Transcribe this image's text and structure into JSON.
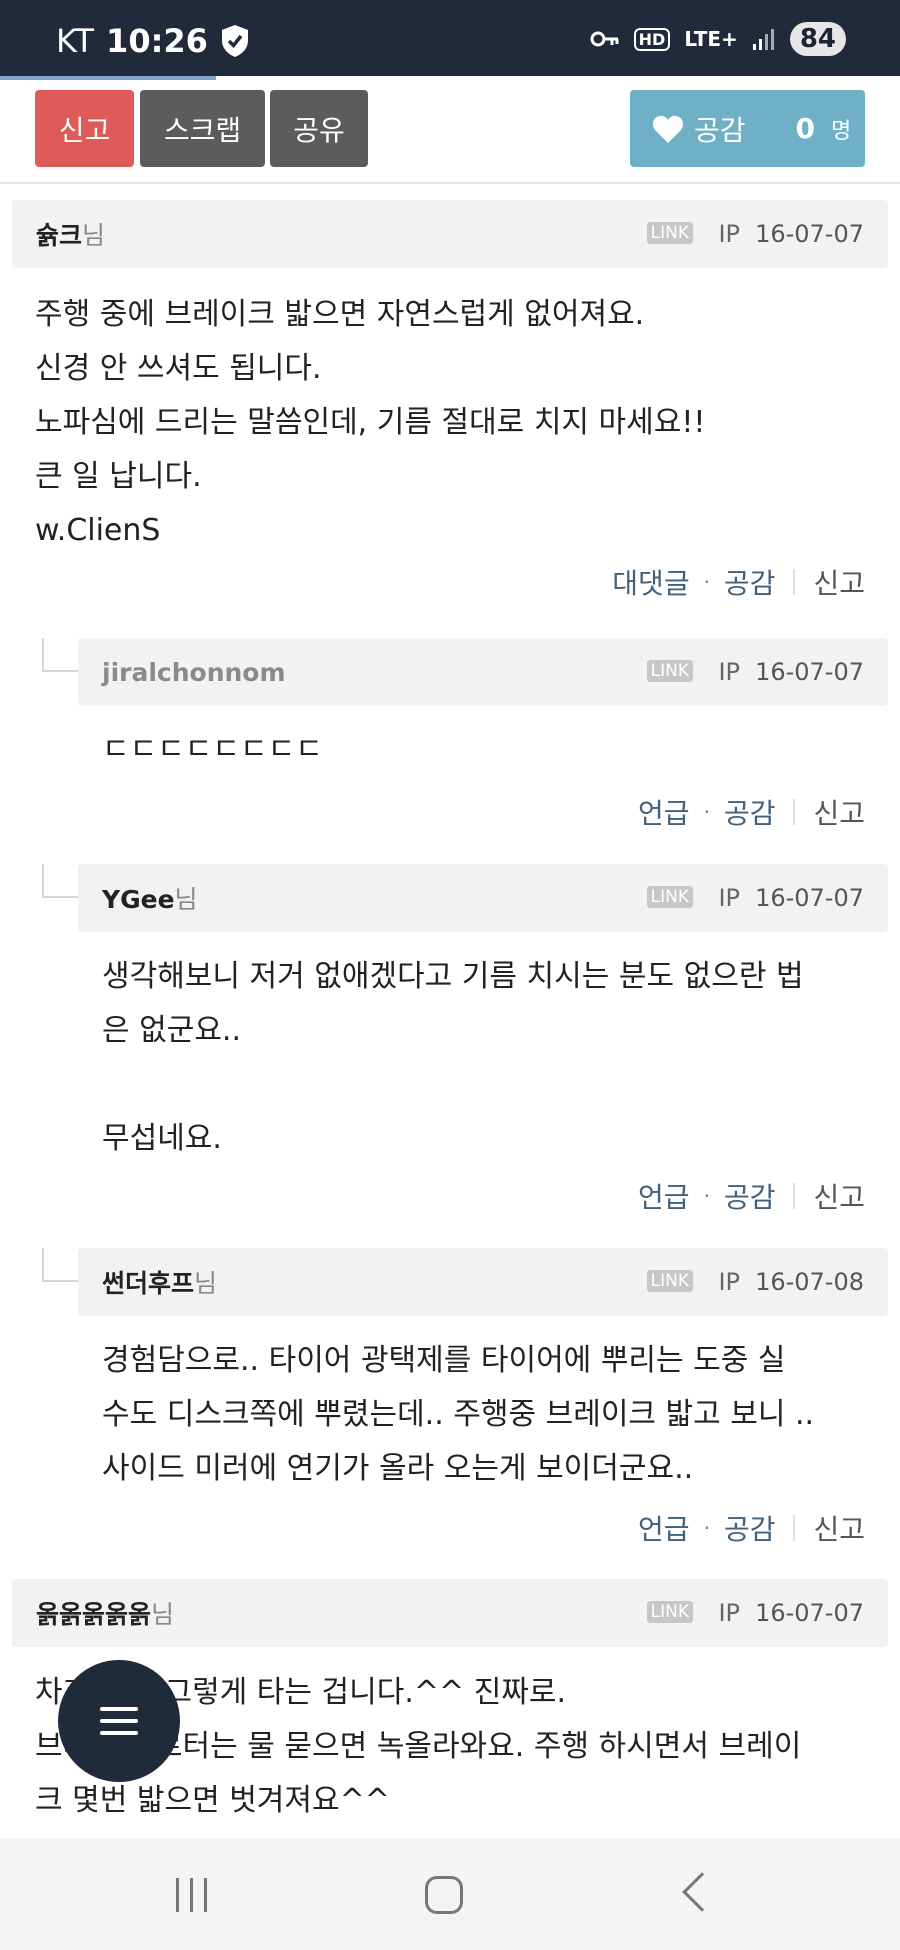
{
  "status": {
    "carrier": "KT",
    "time": "10:26",
    "network": "LTE+",
    "hd": "HD",
    "battery": "84"
  },
  "progress": 0.24,
  "actions": {
    "report": "신고",
    "scrap": "스크랩",
    "share": "공유",
    "like": "공감",
    "like_count": "0",
    "like_unit": "명"
  },
  "labels": {
    "link": "LINK",
    "ip": "IP",
    "nim": "님",
    "reply": "대댓글",
    "mention": "언급",
    "like": "공감",
    "report": "신고"
  },
  "comments": [
    {
      "author": "슑크",
      "date": "16-07-07",
      "body": "주행 중에 브레이크 밟으면 자연스럽게 없어져요.\n신경 안 쓰셔도 됩니다.\n노파심에 드리는 말씀인데, 기름 절대로 치지 마세요!!\n큰 일 납니다.\nw.ClienS"
    },
    {
      "author": "jiralchonnom",
      "date": "16-07-07",
      "body": "ㄷㄷㄷㄷㄷㄷㄷㄷ"
    },
    {
      "author": "YGee",
      "date": "16-07-07",
      "body": "생각해보니 저거 없애겠다고 기름 치시는 분도 없으란 법\n은 없군요..\n\n무섭네요."
    },
    {
      "author": "썬더후프",
      "date": "16-07-08",
      "body": "경험담으로.. 타이어 광택제를 타이어에 뿌리는 도중 실\n수도 디스크쪽에 뿌렸는데.. 주행중 브레이크 밟고 보니 ..\n사이드 미러에 연기가 올라 오는게 보이더군요.."
    },
    {
      "author": "옭옭옭옭옭",
      "date": "16-07-07",
      "body": "차가 원래 그렇게 타는 겁니다.^^ 진짜로.\n브레이크 로터는 물 묻으면 녹올라와요. 주행 하시면서 브레이\n크 몇번 밟으면 벗겨져요^^"
    }
  ]
}
